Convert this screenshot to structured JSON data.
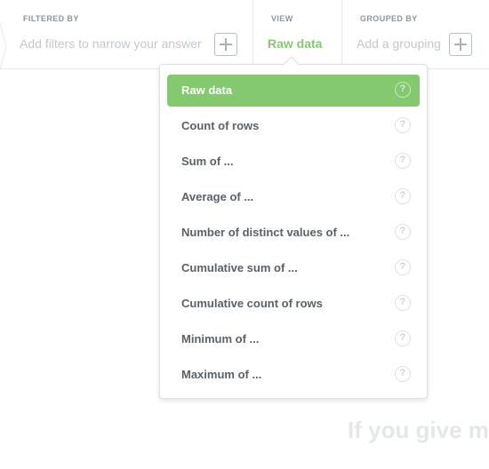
{
  "query_builder": {
    "filters": {
      "label": "FILTERED BY",
      "placeholder": "Add filters to narrow your answer"
    },
    "view": {
      "label": "VIEW",
      "value": "Raw data"
    },
    "grouped": {
      "label": "GROUPED BY",
      "placeholder": "Add a grouping"
    }
  },
  "view_menu": {
    "selected_index": 0,
    "items": [
      {
        "label": "Raw data"
      },
      {
        "label": "Count of rows"
      },
      {
        "label": "Sum of ..."
      },
      {
        "label": "Average of ..."
      },
      {
        "label": "Number of distinct values of ..."
      },
      {
        "label": "Cumulative sum of ..."
      },
      {
        "label": "Cumulative count of rows"
      },
      {
        "label": "Minimum of ..."
      },
      {
        "label": "Maximum of ..."
      }
    ],
    "help_glyph": "?"
  },
  "background": {
    "heading": "If you give me"
  },
  "colors": {
    "accent_green": "#84c96f",
    "muted_text": "#c2c8ce",
    "label_text": "#8c959e"
  },
  "icons": {
    "add": "plus-icon",
    "help": "question-circle-icon",
    "step": "chevron-right-icon"
  }
}
